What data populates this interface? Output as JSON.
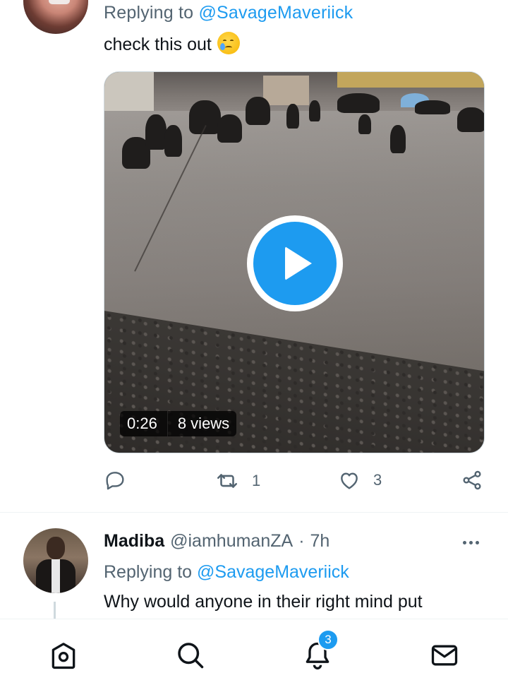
{
  "tweet1": {
    "replying_prefix": "Replying to",
    "replying_handle": "@SavageMaveriick",
    "text": "check this out",
    "emoji": "crying-face-emoji",
    "media": {
      "type": "video",
      "duration": "0:26",
      "views": "8 views"
    },
    "actions": {
      "reply_count": "",
      "retweet_count": "1",
      "like_count": "3"
    }
  },
  "tweet2": {
    "display_name": "Madiba",
    "handle": "@iamhumanZA",
    "separator": "·",
    "time": "7h",
    "replying_prefix": "Replying to",
    "replying_handle": "@SavageMaveriick",
    "text": "Why would anyone in their right mind put"
  },
  "bottom_nav": {
    "items": [
      "home-icon",
      "search-icon",
      "notifications-icon",
      "messages-icon"
    ],
    "notifications_badge": "3"
  },
  "colors": {
    "accent": "#1d9bf0",
    "muted": "#536471",
    "divider": "#eff3f4"
  }
}
